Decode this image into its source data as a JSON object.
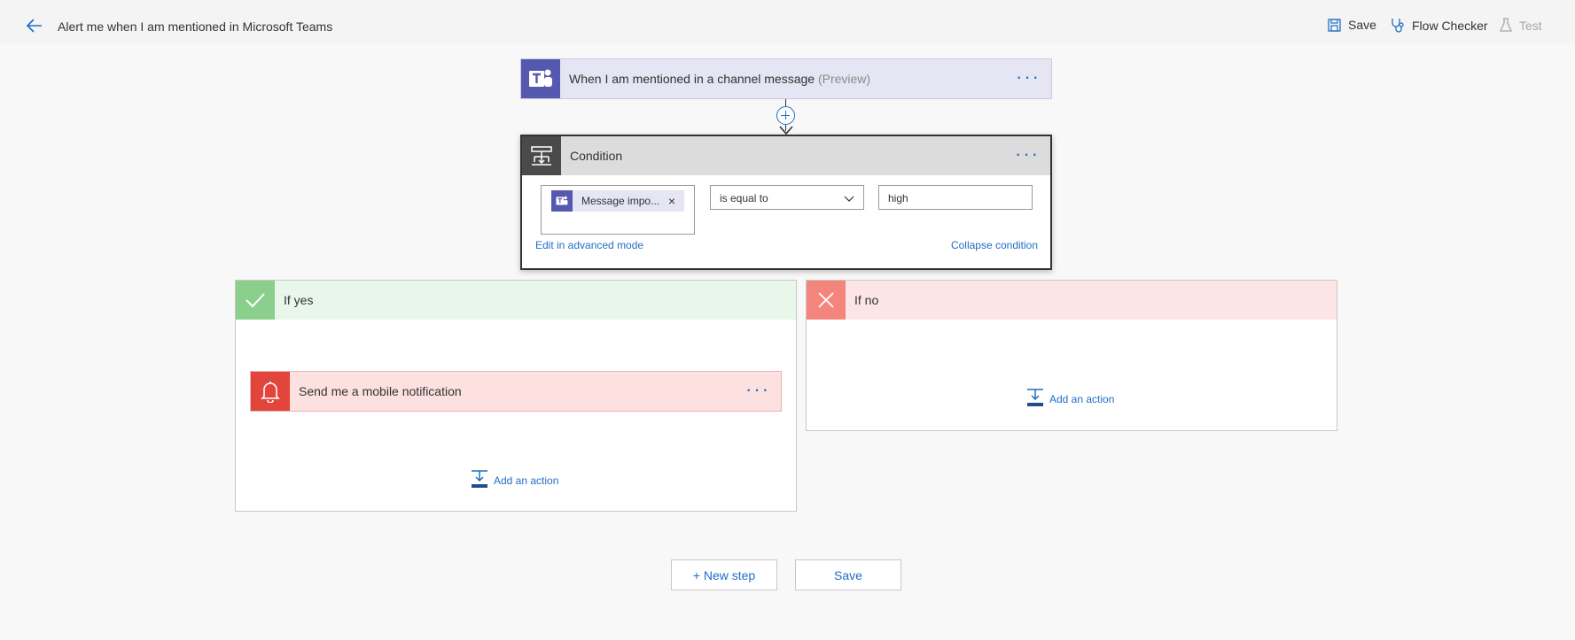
{
  "header": {
    "title": "Alert me when I am mentioned in Microsoft Teams",
    "save_label": "Save",
    "flow_checker_label": "Flow Checker",
    "test_label": "Test"
  },
  "trigger": {
    "title": "When I am mentioned in a channel message",
    "tag": "(Preview)"
  },
  "condition": {
    "title": "Condition",
    "token_label": "Message impo...",
    "operator": "is equal to",
    "value": "high",
    "edit_advanced_link": "Edit in advanced mode",
    "collapse_link": "Collapse condition"
  },
  "if_yes": {
    "title": "If yes",
    "action_title": "Send me a mobile notification",
    "add_action_label": "Add an action"
  },
  "if_no": {
    "title": "If no",
    "add_action_label": "Add an action"
  },
  "footer": {
    "new_step_label": "+ New step",
    "save_label": "Save"
  },
  "colors": {
    "teams": "#5558af",
    "accent": "#1f6fc4",
    "yes": "#8ad08c",
    "no": "#f4857d",
    "notification": "#e2453c"
  }
}
